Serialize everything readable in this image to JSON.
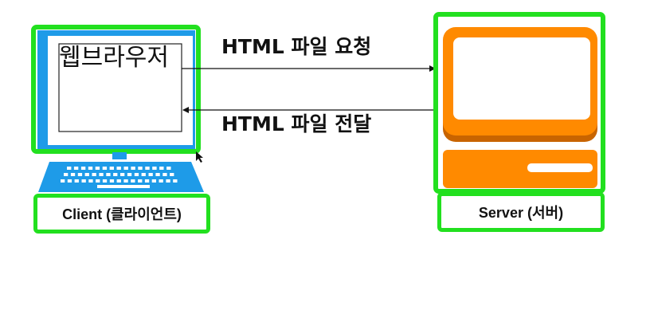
{
  "diagram": {
    "browser_label": "웹브라우저",
    "request_label": "HTML 파일 요청",
    "response_label": "HTML 파일 전달",
    "client_caption": "Client (클라이언트)",
    "server_caption": "Server (서버)"
  },
  "colors": {
    "highlight_green": "#22e01f",
    "monitor_blue": "#1e9be8",
    "keyboard_blue": "#1e9be8",
    "server_orange": "#ff8a00",
    "server_dark_orange": "#c86400",
    "white": "#ffffff",
    "line": "#111111"
  }
}
